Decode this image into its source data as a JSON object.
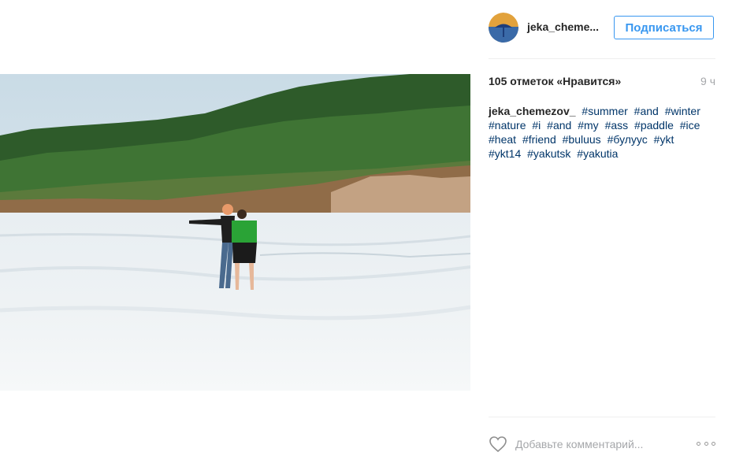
{
  "post": {
    "username": "jeka_cheme...",
    "follow_label": "Подписаться",
    "likes": "105 отметок «Нравится»",
    "time_ago": "9 ч",
    "caption_author": "jeka_chemezov_",
    "hashtags": [
      "#summer",
      "#and",
      "#winter",
      "#nature",
      "#i",
      "#and",
      "#my",
      "#ass",
      "#paddle",
      "#ice",
      "#heat",
      "#friend",
      "#buluus",
      "#булуус",
      "#ykt",
      "#ykt14",
      "#yakutsk",
      "#yakutia"
    ],
    "comment_placeholder": "Добавьте комментарий...",
    "icons": [
      "heart-icon",
      "more-options-icon",
      "avatar"
    ],
    "colors": {
      "accent": "#3897f0",
      "hashtag": "#003569",
      "muted": "#a5a7aa"
    }
  }
}
